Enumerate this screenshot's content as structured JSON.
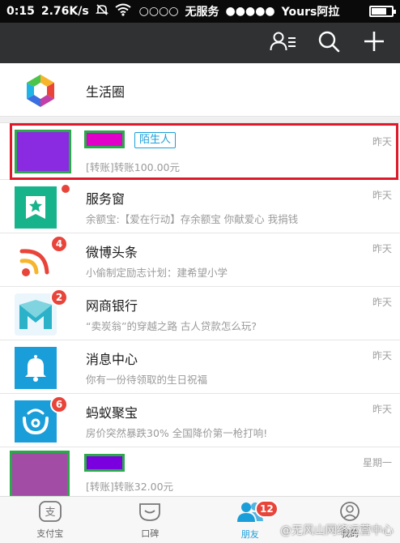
{
  "status_bar": {
    "time": "0:15",
    "speed": "2.76K/s",
    "signal_left": "○○○○",
    "carrier_left": "无服务",
    "signal_right": "●●●●●",
    "carrier_right": "Yours阿拉"
  },
  "life_circle": {
    "label": "生活圈"
  },
  "conversations": [
    {
      "title": "",
      "tag": "陌生人",
      "subtitle": "[转账]转账100.00元",
      "time": "昨天",
      "avatar_color": "#8a2be2",
      "name_color": "#e000c8",
      "badge": ""
    },
    {
      "title": "服务窗",
      "subtitle": "余额宝:【爱在行动】存余额宝 你献爱心 我捐钱",
      "time": "昨天",
      "badge": ""
    },
    {
      "title": "微博头条",
      "subtitle": "小偷制定励志计划：建希望小学",
      "time": "昨天",
      "badge": "4"
    },
    {
      "title": "网商银行",
      "subtitle": "“卖炭翁”的穿越之路 古人贷款怎么玩?",
      "time": "昨天",
      "badge": "2"
    },
    {
      "title": "消息中心",
      "subtitle": "你有一份待领取的生日祝福",
      "time": "昨天",
      "badge": ""
    },
    {
      "title": "蚂蚁聚宝",
      "subtitle": "房价突然暴跌30% 全国降价第一枪打响!",
      "time": "昨天",
      "badge": "6"
    },
    {
      "title": "",
      "subtitle": "[转账]转账32.00元",
      "time": "星期一",
      "avatar_color": "#a24ca6",
      "name_color": "#7b00e0",
      "badge": ""
    }
  ],
  "tabbar": {
    "tabs": [
      {
        "label": "支付宝",
        "icon": "alipay-icon"
      },
      {
        "label": "口碑",
        "icon": "koubei-icon"
      },
      {
        "label": "朋友",
        "icon": "friends-icon",
        "badge": "12",
        "active": true
      },
      {
        "label": "我的",
        "icon": "me-icon"
      }
    ]
  },
  "watermark": "@无风山网络运营中心",
  "colors": {
    "header_bg": "#2f3133",
    "accent": "#1a9ed9",
    "badge": "#e8443a",
    "highlight_border": "#e0192a",
    "mask_border": "#2aa84a"
  }
}
